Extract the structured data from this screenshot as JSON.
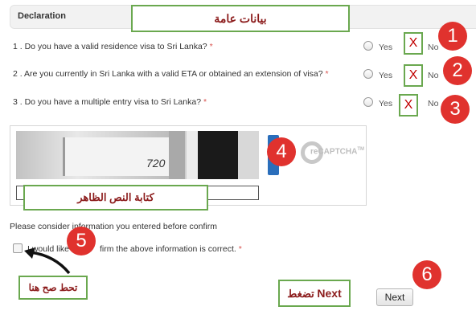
{
  "header": {
    "title": "Declaration",
    "label_ar": "بيانات عامة"
  },
  "questions": [
    {
      "number": "1",
      "text": "1 . Do you have a valid residence visa to Sri Lanka?",
      "required": "*",
      "yes": "Yes",
      "no": "No",
      "mark": "X",
      "step": "1"
    },
    {
      "number": "2",
      "text": "2 . Are you currently in Sri Lanka with a valid ETA or obtained an extension of visa?",
      "required": "*",
      "yes": "Yes",
      "no": "No",
      "mark": "X",
      "step": "2"
    },
    {
      "number": "3",
      "text": "3 . Do you have a multiple entry visa to Sri Lanka?",
      "required": "*",
      "yes": "Yes",
      "no": "No",
      "mark": "X",
      "step": "3"
    }
  ],
  "captcha": {
    "step": "4",
    "brand": "reCAPTCHA",
    "tm": "TM",
    "image_text": "720",
    "label_ar": "كتابة النص الظاهر"
  },
  "confirm": {
    "note": "Please consider information you entered before confirm",
    "checkbox_label_part1": "I would like",
    "checkbox_label_part2": "firm the above information is correct.",
    "required": "*",
    "step": "5",
    "hint_ar": "تحط صح هنا"
  },
  "next": {
    "button_label": "Next",
    "step": "6",
    "hint_bold": "Next",
    "hint_ar": "تضغط"
  },
  "colors": {
    "annotation_red": "#e0322e",
    "annotation_green": "#6aa84f",
    "x_mark": "#c00000"
  }
}
